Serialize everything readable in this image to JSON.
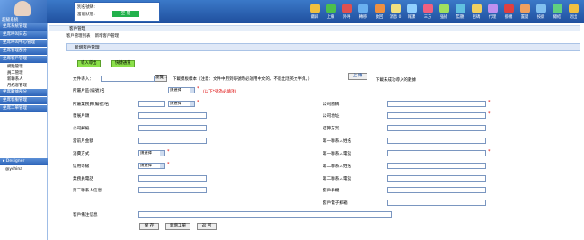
{
  "header": {
    "brand": "超級系統",
    "account_label": "別名號碼:",
    "status_label": "當前狀態:",
    "online_button": "空 閒"
  },
  "toolbar": [
    {
      "label": "鍵屏",
      "icon": "lock-icon",
      "color": "#f0c040"
    },
    {
      "label": "上線",
      "icon": "online-icon",
      "color": "#4cc04c"
    },
    {
      "label": "外呼",
      "icon": "phone-out-icon",
      "color": "#e05050"
    },
    {
      "label": "轉移",
      "icon": "transfer-icon",
      "color": "#6ab0f0"
    },
    {
      "label": "收回",
      "icon": "recall-icon",
      "color": "#f09040"
    },
    {
      "label": "消息 0",
      "icon": "message-icon",
      "color": "#f0e080"
    },
    {
      "label": "報課",
      "icon": "report-icon",
      "color": "#90d0ff"
    },
    {
      "label": "三方",
      "icon": "conference-icon",
      "color": "#f06080"
    },
    {
      "label": "強插",
      "icon": "barge-in-icon",
      "color": "#a0e060"
    },
    {
      "label": "監聽",
      "icon": "monitor-icon",
      "color": "#60c0e0"
    },
    {
      "label": "密碼",
      "icon": "password-icon",
      "color": "#f0d060"
    },
    {
      "label": "代理",
      "icon": "proxy-icon",
      "color": "#c090f0"
    },
    {
      "label": "掛機",
      "icon": "hangup-icon",
      "color": "#e04040"
    },
    {
      "label": "置疑",
      "icon": "hold-icon",
      "color": "#f0a060"
    },
    {
      "label": "按鍵",
      "icon": "keypad-icon",
      "color": "#80c0f0"
    },
    {
      "label": "總結",
      "icon": "summary-icon",
      "color": "#60d080"
    },
    {
      "label": "退出",
      "icon": "exit-icon",
      "color": "#f0c040"
    }
  ],
  "sidebar": {
    "groups": [
      {
        "label": "坐席系統管理"
      },
      {
        "label": "坐席呼叫日志"
      },
      {
        "label": "坐席呼叫中心管理"
      },
      {
        "label": "坐席管理部分"
      },
      {
        "label": "坐席客戶管理",
        "items": [
          "網點管理",
          "員工管理",
          "新聯系人",
          "月結客管理"
        ]
      },
      {
        "label": "坐席數據部分"
      },
      {
        "label": "坐席客服管理"
      },
      {
        "label": "坐席工單管理"
      }
    ],
    "designer": "Designer",
    "designer_sub": "@ychina"
  },
  "main": {
    "breadcrumb": "客戶管理",
    "tabs": [
      "客戶管理列表",
      "新增客戶管理"
    ],
    "section": "新增客戶管理",
    "btn_import": "導入導出",
    "btn_quick": "快捷通道",
    "file_label": "文件導入：",
    "browse": "瀏覽...",
    "file_hint": "下載模板樣本（注意：文件中用到每號時必須用中文的，不能出現英文半角。）",
    "upload": "上 傳",
    "upload_hint": "下載未成功導入的數據",
    "select_default": "請選擇",
    "required_hint": "(以下*號為必填項)",
    "fields": {
      "area": "所屬片區(編號)名",
      "branch": "所屬業務員(編號)名",
      "dev_user": "發展戶頭",
      "company_email": "公司郵編",
      "balance": "當前月金額",
      "consume": "消費方式",
      "credit": "信用等級",
      "biz_phone": "業務員電話",
      "contact2": "第二聯系人信息",
      "company_short": "公司簡稱",
      "company_addr": "公司地址",
      "settle": "結算方案",
      "contact1_name": "第一聯系人姓名",
      "contact1_phone": "第一聯系人電話",
      "contact2_name": "第二聯系人姓名",
      "contact2_phone": "第二聯系人電話",
      "customer_mobile": "客戶手機",
      "customer_email": "客戶電子郵箱",
      "remark": "客戶備注信息"
    },
    "save": "保 存",
    "add_order": "新增工單",
    "back": "返 回"
  }
}
